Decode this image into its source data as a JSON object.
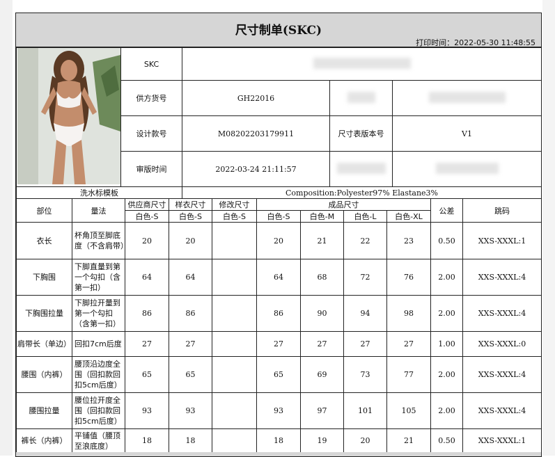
{
  "title": "尺寸制单(SKC)",
  "print_time": "打印时间：2022-05-30 11:48:55",
  "info": {
    "skc_label": "SKC",
    "supplier_no_label": "供方货号",
    "supplier_no": "GH22016",
    "design_no_label": "设计款号",
    "design_no": "M08202203179911",
    "size_version_label": "尺寸表版本号",
    "size_version": "V1",
    "review_time_label": "审版时间",
    "review_time": "2022-03-24 21:11:57",
    "wash_label_label": "洗水标模板",
    "composition": "Composition:Polyester97% Elastane3%"
  },
  "header": {
    "part": "部位",
    "method": "量法",
    "supplier_size": "供应商尺寸",
    "sample_size": "样衣尺寸",
    "modify_size": "修改尺寸",
    "finished_size": "成品尺寸",
    "tolerance": "公差",
    "jump": "跳码",
    "sub_supplier": "白色-S",
    "sub_sample": "白色-S",
    "sub_modify": "白色-S",
    "sizes": [
      "白色-S",
      "白色-M",
      "白色-L",
      "白色-XL"
    ]
  },
  "rows": [
    {
      "part": "衣长",
      "method": "杯角顶至脚底度（不含肩带）",
      "supplier": "20",
      "sample": "20",
      "modify": "",
      "s": "20",
      "m": "21",
      "l": "22",
      "xl": "23",
      "tol": "0.50",
      "jump": "XXS-XXXL:1"
    },
    {
      "part": "下胸围",
      "method": "下脚直量到第一个勾扣（含第一扣）",
      "supplier": "64",
      "sample": "64",
      "modify": "",
      "s": "64",
      "m": "68",
      "l": "72",
      "xl": "76",
      "tol": "2.00",
      "jump": "XXS-XXXL:4"
    },
    {
      "part": "下胸围拉量",
      "method": "下脚拉开量到第一个勾扣（含第一扣）",
      "supplier": "86",
      "sample": "86",
      "modify": "",
      "s": "86",
      "m": "90",
      "l": "94",
      "xl": "98",
      "tol": "2.00",
      "jump": "XXS-XXXL:4"
    },
    {
      "part": "肩带长（单边）",
      "method": "回扣7cm后度",
      "supplier": "27",
      "sample": "27",
      "modify": "",
      "s": "27",
      "m": "27",
      "l": "27",
      "xl": "27",
      "tol": "1.00",
      "jump": "XXS-XXXL:0"
    },
    {
      "part": "腰围（内裤）",
      "method": "腰顶沿边度全围（回扣款回扣5cm后度）",
      "supplier": "65",
      "sample": "65",
      "modify": "",
      "s": "65",
      "m": "69",
      "l": "73",
      "xl": "77",
      "tol": "2.00",
      "jump": "XXS-XXXL:4"
    },
    {
      "part": "腰围拉量",
      "method": "腰位拉开度全围（回扣款回扣5cm后度）",
      "supplier": "93",
      "sample": "93",
      "modify": "",
      "s": "93",
      "m": "97",
      "l": "101",
      "xl": "105",
      "tol": "2.00",
      "jump": "XXS-XXXL:4"
    },
    {
      "part": "裤长（内裤）",
      "method": "平铺值（腰顶至浪底度）",
      "supplier": "18",
      "sample": "18",
      "modify": "",
      "s": "18",
      "m": "19",
      "l": "20",
      "xl": "21",
      "tol": "0.50",
      "jump": "XXS-XXXL:1"
    }
  ]
}
